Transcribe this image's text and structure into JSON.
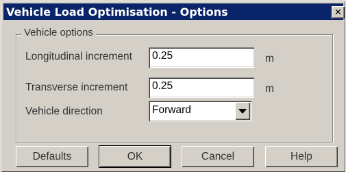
{
  "window": {
    "title": "Vehicle Load Optimisation - Options",
    "close_glyph": "✕"
  },
  "group": {
    "legend": "Vehicle options",
    "fields": [
      {
        "label": "Longitudinal increment",
        "value": "0.25",
        "unit": "m"
      },
      {
        "label": "Transverse increment",
        "value": "0.25",
        "unit": "m"
      }
    ],
    "direction": {
      "label": "Vehicle direction",
      "selected": "Forward"
    }
  },
  "buttons": {
    "defaults": "Defaults",
    "ok": "OK",
    "cancel": "Cancel",
    "help": "Help"
  },
  "colors": {
    "titlebar": "#0a246a",
    "face": "#d4d0c8"
  }
}
